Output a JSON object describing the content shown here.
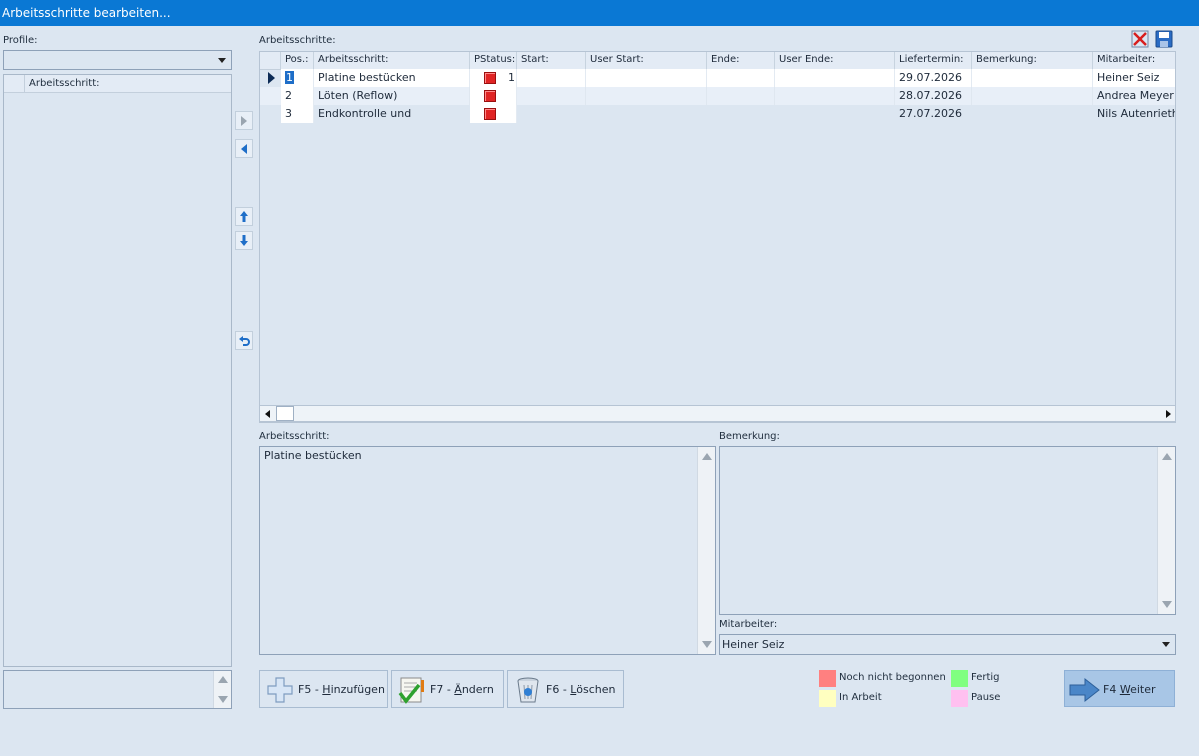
{
  "window": {
    "title": "Arbeitsschritte bearbeiten..."
  },
  "left": {
    "profile_label": "Profile:",
    "profile_value": "",
    "list_header": "Arbeitsschritt:"
  },
  "grid": {
    "label": "Arbeitsschritte:",
    "columns": [
      "Pos.:",
      "Arbeitsschritt:",
      "PStatus:",
      "Start:",
      "User Start:",
      "Ende:",
      "User Ende:",
      "Liefertermin:",
      "Bemerkung:",
      "Mitarbeiter:"
    ],
    "rows": [
      {
        "pos": "1",
        "step": "Platine bestücken",
        "status_color": "#e02424",
        "pstatus": "1",
        "start": "",
        "user_start": "",
        "end": "",
        "user_end": "",
        "due": "29.07.2026",
        "remark": "",
        "employee": "Heiner Seiz"
      },
      {
        "pos": "2",
        "step": "Löten (Reflow)",
        "status_color": "#e02424",
        "pstatus": "",
        "start": "",
        "user_start": "",
        "end": "",
        "user_end": "",
        "due": "28.07.2026",
        "remark": "",
        "employee": "Andrea Meyer"
      },
      {
        "pos": "3",
        "step": "Endkontrolle und",
        "status_color": "#e02424",
        "pstatus": "",
        "start": "",
        "user_start": "",
        "end": "",
        "user_end": "",
        "due": "27.07.2026",
        "remark": "",
        "employee": "Nils Autenrieth"
      }
    ]
  },
  "detail": {
    "step_label": "Arbeitsschritt:",
    "step_text": "Platine bestücken",
    "remark_label": "Bemerkung:",
    "remark_text": "",
    "employee_label": "Mitarbeiter:",
    "employee_value": "Heiner Seiz"
  },
  "buttons": {
    "add": {
      "key": "F5 - ",
      "mnemonic": "H",
      "rest": "inzufügen"
    },
    "edit": {
      "key": "F7 - ",
      "mnemonic": "Ä",
      "rest": "ndern"
    },
    "delete": {
      "key": "F6 - ",
      "mnemonic": "L",
      "rest": "öschen"
    },
    "next": {
      "key": "F4 ",
      "mnemonic": "W",
      "rest": "eiter"
    }
  },
  "legend": [
    {
      "label": "Noch nicht begonnen",
      "color": "#ff8080"
    },
    {
      "label": "Fertig",
      "color": "#80ff80"
    },
    {
      "label": "In Arbeit",
      "color": "#ffffc0"
    },
    {
      "label": "Pause",
      "color": "#ffc0f0"
    }
  ],
  "icons": [
    "close-red-x-icon",
    "save-disk-icon",
    "arrow-right-icon",
    "arrow-left-icon",
    "arrow-up-icon",
    "arrow-down-icon",
    "undo-icon",
    "plus-icon",
    "check-edit-icon",
    "trash-icon",
    "forward-arrow-icon"
  ]
}
